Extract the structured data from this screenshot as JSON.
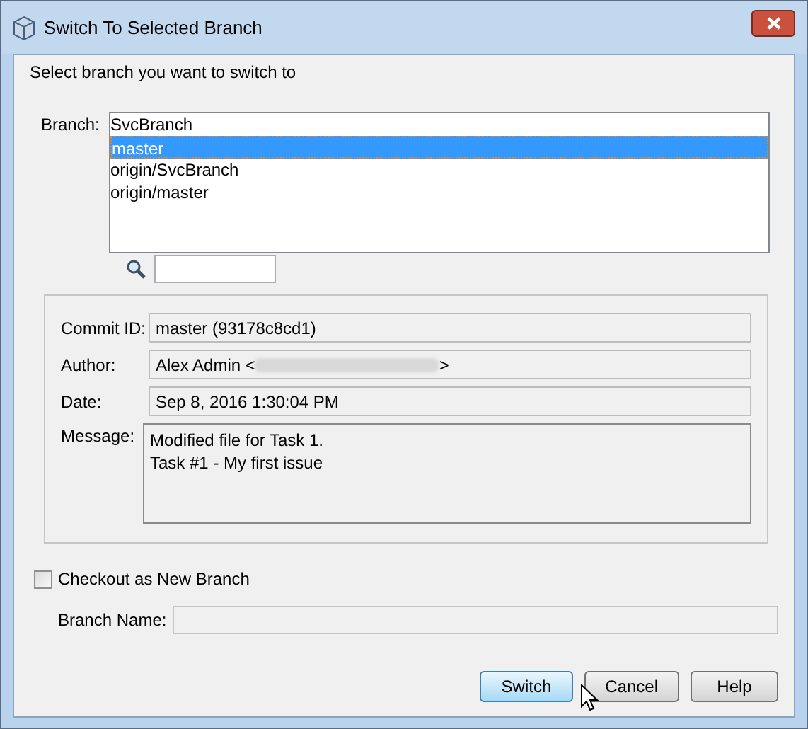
{
  "window": {
    "title": "Switch To Selected Branch"
  },
  "prompt": "Select branch you want to switch to",
  "branch_label": "Branch:",
  "branches": [
    {
      "name": "SvcBranch",
      "selected": false
    },
    {
      "name": "master",
      "selected": true
    },
    {
      "name": "origin/SvcBranch",
      "selected": false
    },
    {
      "name": "origin/master",
      "selected": false
    }
  ],
  "details": {
    "commit_label": "Commit ID:",
    "commit": "master (93178c8cd1)",
    "author_label": "Author:",
    "author_prefix": "Alex Admin <",
    "author_suffix": ">",
    "date_label": "Date:",
    "date": "Sep 8, 2016 1:30:04 PM",
    "message_label": "Message:",
    "message": [
      "Modified file for Task 1.",
      "Task #1 - My first issue"
    ]
  },
  "checkout": {
    "label": "Checkout as New Branch",
    "checked": false
  },
  "branch_name_label": "Branch Name:",
  "buttons": [
    {
      "label": "Switch",
      "selected": true
    },
    {
      "label": "Cancel",
      "selected": false
    },
    {
      "label": "Help",
      "selected": false
    }
  ]
}
